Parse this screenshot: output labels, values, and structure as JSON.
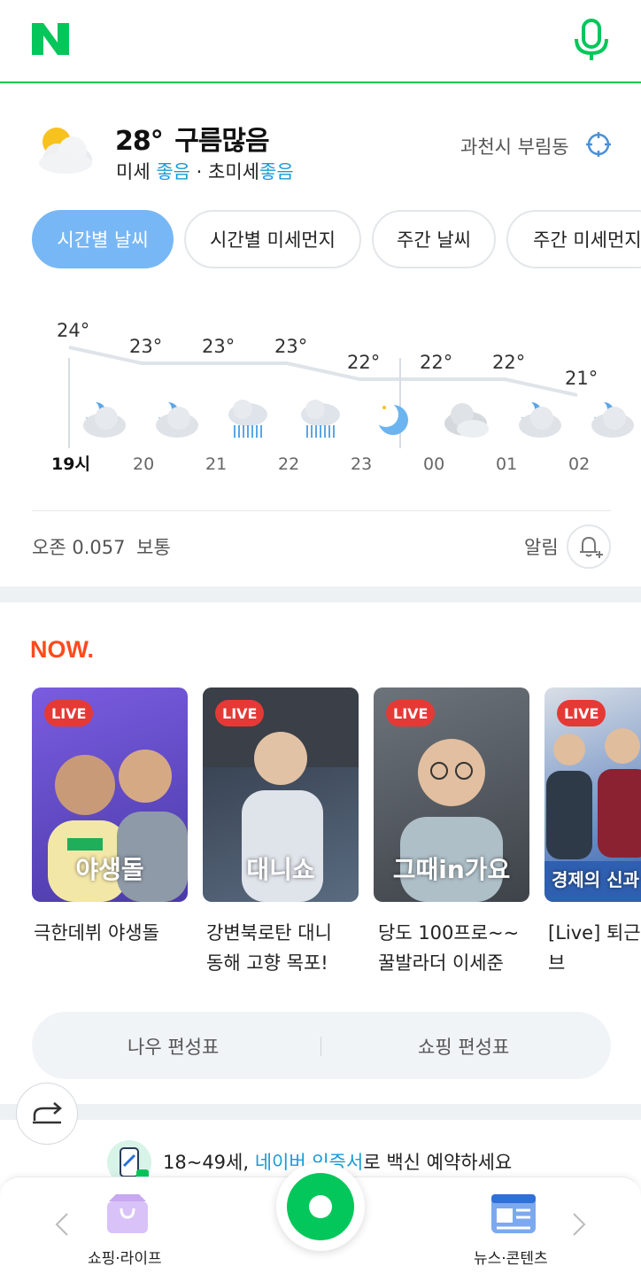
{
  "header": {
    "logo_letter": "N"
  },
  "weather": {
    "temperature": "28°",
    "condition": "구름많음",
    "fine_dust_label": "미세",
    "fine_dust_value": "좋음",
    "separator": "·",
    "ultra_fine_dust_label": "초미세",
    "ultra_fine_dust_value": "좋음",
    "location": "과천시 부림동"
  },
  "tabs": [
    {
      "label": "시간별 날씨",
      "active": true
    },
    {
      "label": "시간별 미세먼지",
      "active": false
    },
    {
      "label": "주간 날씨",
      "active": false
    },
    {
      "label": "주간 미세먼지",
      "active": false
    }
  ],
  "hourly": [
    {
      "hour": "19시",
      "temp": "24°",
      "icon": "partly-cloudy-icon"
    },
    {
      "hour": "20",
      "temp": "23°",
      "icon": "partly-cloudy-icon"
    },
    {
      "hour": "21",
      "temp": "23°",
      "icon": "rain-icon"
    },
    {
      "hour": "22",
      "temp": "23°",
      "icon": "rain-icon"
    },
    {
      "hour": "23",
      "temp": "22°",
      "icon": "moon-icon"
    },
    {
      "hour": "00",
      "temp": "22°",
      "icon": "cloudy-icon"
    },
    {
      "hour": "01",
      "temp": "22°",
      "icon": "partly-cloudy-icon"
    },
    {
      "hour": "02",
      "temp": "21°",
      "icon": "partly-cloudy-icon"
    }
  ],
  "chart_data": {
    "type": "line",
    "x": [
      "19시",
      "20",
      "21",
      "22",
      "23",
      "00",
      "01",
      "02"
    ],
    "series": [
      {
        "values": [
          24,
          23,
          23,
          23,
          22,
          22,
          22,
          21
        ]
      }
    ]
  },
  "ozone": {
    "label": "오존",
    "value": "0.057",
    "status": "보통"
  },
  "alarm": {
    "label": "알림"
  },
  "now": {
    "logo_text": "NOW.",
    "cards": [
      {
        "badge": "LIVE",
        "logo": "야생돌",
        "title_line1": "극한데뷔 야생돌",
        "title_line2": "",
        "color": "#6a5acd"
      },
      {
        "badge": "LIVE",
        "logo": "대니쇼",
        "title_line1": "강변북로탄 대니",
        "title_line2": "동해 고향 목포!",
        "color": "#3b4a5e"
      },
      {
        "badge": "LIVE",
        "logo": "그때in가요",
        "title_line1": "당도 100프로~~",
        "title_line2": "꿀발라더 이세준",
        "color": "#8a8f96"
      },
      {
        "badge": "LIVE",
        "logo": "경제의 신과",
        "title_line1": "[Live] 퇴근길",
        "title_line2": "브",
        "color": "#2f5fb0"
      }
    ],
    "schedule_left": "나우 편성표",
    "schedule_right": "쇼핑 편성표"
  },
  "promo": {
    "prefix": "18~49세, ",
    "highlight": "네이버 인증서",
    "suffix": "로 백신 예약하세요"
  },
  "bottom_nav": {
    "left_label": "쇼핑·라이프",
    "right_label": "뉴스·콘텐츠"
  },
  "colors": {
    "brand_green": "#03c75a",
    "active_chip": "#78b7f5",
    "good_blue": "#1a9ad6",
    "live_red": "#e53935"
  }
}
